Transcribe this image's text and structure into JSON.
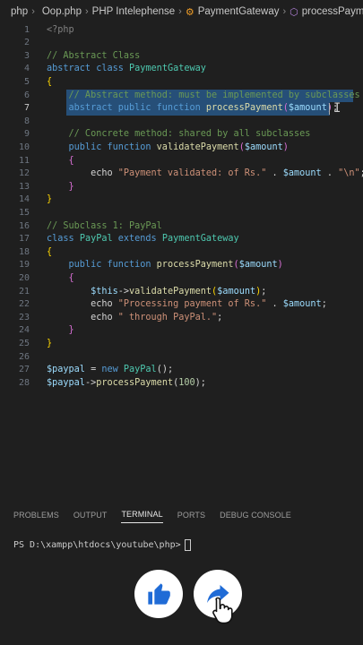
{
  "breadcrumb": {
    "items": [
      "php",
      "Oop.php",
      "PHP Intelephense",
      "PaymentGateway",
      "processPayment"
    ]
  },
  "editor": {
    "active_line": 7,
    "lines": [
      {
        "n": "1",
        "tokens": [
          {
            "t": "<?php",
            "c": "t-tag"
          }
        ]
      },
      {
        "n": "2",
        "tokens": []
      },
      {
        "n": "3",
        "tokens": [
          {
            "t": "// Abstract Class",
            "c": "t-cm"
          }
        ]
      },
      {
        "n": "4",
        "tokens": [
          {
            "t": "abstract class ",
            "c": "t-kw"
          },
          {
            "t": "PaymentGateway",
            "c": "t-cls"
          }
        ]
      },
      {
        "n": "5",
        "tokens": [
          {
            "t": "{",
            "c": "t-br"
          }
        ]
      },
      {
        "n": "6",
        "tokens": [
          {
            "t": "    // Abstract method: must be implemented by subclasses",
            "c": "t-cm"
          }
        ]
      },
      {
        "n": "7",
        "tokens": [
          {
            "t": "    abstract public function ",
            "c": "t-kw"
          },
          {
            "t": "processPayment",
            "c": "t-fn"
          },
          {
            "t": "(",
            "c": "t-br2"
          },
          {
            "t": "$amount",
            "c": "t-var"
          },
          {
            "t": ")",
            "c": "t-br2"
          },
          {
            "t": ";",
            "c": "t-pl"
          }
        ]
      },
      {
        "n": "8",
        "tokens": []
      },
      {
        "n": "9",
        "tokens": [
          {
            "t": "    // Concrete method: shared by all subclasses",
            "c": "t-cm"
          }
        ]
      },
      {
        "n": "10",
        "tokens": [
          {
            "t": "    public function ",
            "c": "t-kw"
          },
          {
            "t": "validatePayment",
            "c": "t-fn"
          },
          {
            "t": "(",
            "c": "t-br2"
          },
          {
            "t": "$amount",
            "c": "t-var"
          },
          {
            "t": ")",
            "c": "t-br2"
          }
        ]
      },
      {
        "n": "11",
        "tokens": [
          {
            "t": "    {",
            "c": "t-br2"
          }
        ]
      },
      {
        "n": "12",
        "tokens": [
          {
            "t": "        echo ",
            "c": "t-pl"
          },
          {
            "t": "\"Payment validated: of Rs.\"",
            "c": "t-str"
          },
          {
            "t": " . ",
            "c": "t-op"
          },
          {
            "t": "$amount",
            "c": "t-var"
          },
          {
            "t": " . ",
            "c": "t-op"
          },
          {
            "t": "\"\\n\"",
            "c": "t-str"
          },
          {
            "t": ";",
            "c": "t-pl"
          }
        ]
      },
      {
        "n": "13",
        "tokens": [
          {
            "t": "    }",
            "c": "t-br2"
          }
        ]
      },
      {
        "n": "14",
        "tokens": [
          {
            "t": "}",
            "c": "t-br"
          }
        ]
      },
      {
        "n": "15",
        "tokens": []
      },
      {
        "n": "16",
        "tokens": [
          {
            "t": "// Subclass 1: PayPal",
            "c": "t-cm"
          }
        ]
      },
      {
        "n": "17",
        "tokens": [
          {
            "t": "class ",
            "c": "t-kw"
          },
          {
            "t": "PayPal",
            "c": "t-cls"
          },
          {
            "t": " extends ",
            "c": "t-kw"
          },
          {
            "t": "PaymentGateway",
            "c": "t-cls"
          }
        ]
      },
      {
        "n": "18",
        "tokens": [
          {
            "t": "{",
            "c": "t-br"
          }
        ]
      },
      {
        "n": "19",
        "tokens": [
          {
            "t": "    public function ",
            "c": "t-kw"
          },
          {
            "t": "processPayment",
            "c": "t-fn"
          },
          {
            "t": "(",
            "c": "t-br2"
          },
          {
            "t": "$amount",
            "c": "t-var"
          },
          {
            "t": ")",
            "c": "t-br2"
          }
        ]
      },
      {
        "n": "20",
        "tokens": [
          {
            "t": "    {",
            "c": "t-br2"
          }
        ]
      },
      {
        "n": "21",
        "tokens": [
          {
            "t": "        ",
            "c": "t-pl"
          },
          {
            "t": "$this",
            "c": "t-var"
          },
          {
            "t": "->",
            "c": "t-op"
          },
          {
            "t": "validatePayment",
            "c": "t-fn"
          },
          {
            "t": "(",
            "c": "t-br"
          },
          {
            "t": "$amount",
            "c": "t-var"
          },
          {
            "t": ")",
            "c": "t-br"
          },
          {
            "t": ";",
            "c": "t-pl"
          }
        ]
      },
      {
        "n": "22",
        "tokens": [
          {
            "t": "        echo ",
            "c": "t-pl"
          },
          {
            "t": "\"Processing payment of Rs.\"",
            "c": "t-str"
          },
          {
            "t": " . ",
            "c": "t-op"
          },
          {
            "t": "$amount",
            "c": "t-var"
          },
          {
            "t": ";",
            "c": "t-pl"
          }
        ]
      },
      {
        "n": "23",
        "tokens": [
          {
            "t": "        echo ",
            "c": "t-pl"
          },
          {
            "t": "\" through PayPal.\"",
            "c": "t-str"
          },
          {
            "t": ";",
            "c": "t-pl"
          }
        ]
      },
      {
        "n": "24",
        "tokens": [
          {
            "t": "    }",
            "c": "t-br2"
          }
        ]
      },
      {
        "n": "25",
        "tokens": [
          {
            "t": "}",
            "c": "t-br"
          }
        ]
      },
      {
        "n": "26",
        "tokens": []
      },
      {
        "n": "27",
        "tokens": [
          {
            "t": "$paypal",
            "c": "t-var"
          },
          {
            "t": " = ",
            "c": "t-op"
          },
          {
            "t": "new ",
            "c": "t-kw"
          },
          {
            "t": "PayPal",
            "c": "t-cls"
          },
          {
            "t": "();",
            "c": "t-pl"
          }
        ]
      },
      {
        "n": "28",
        "tokens": [
          {
            "t": "$paypal",
            "c": "t-var"
          },
          {
            "t": "->",
            "c": "t-op"
          },
          {
            "t": "processPayment",
            "c": "t-fn"
          },
          {
            "t": "(",
            "c": "t-pl"
          },
          {
            "t": "100",
            "c": "t-num"
          },
          {
            "t": ");",
            "c": "t-pl"
          }
        ]
      }
    ]
  },
  "panel": {
    "tabs": [
      {
        "label": "PROBLEMS",
        "active": false
      },
      {
        "label": "OUTPUT",
        "active": false
      },
      {
        "label": "TERMINAL",
        "active": true
      },
      {
        "label": "PORTS",
        "active": false
      },
      {
        "label": "DEBUG CONSOLE",
        "active": false
      }
    ],
    "terminal_prompt": "PS D:\\xampp\\htdocs\\youtube\\php>"
  },
  "buttons": {
    "like_icon": "thumbs-up-icon",
    "share_icon": "share-arrow-icon"
  },
  "colors": {
    "accent_blue": "#1f6bd6",
    "selection": "#264f78"
  }
}
